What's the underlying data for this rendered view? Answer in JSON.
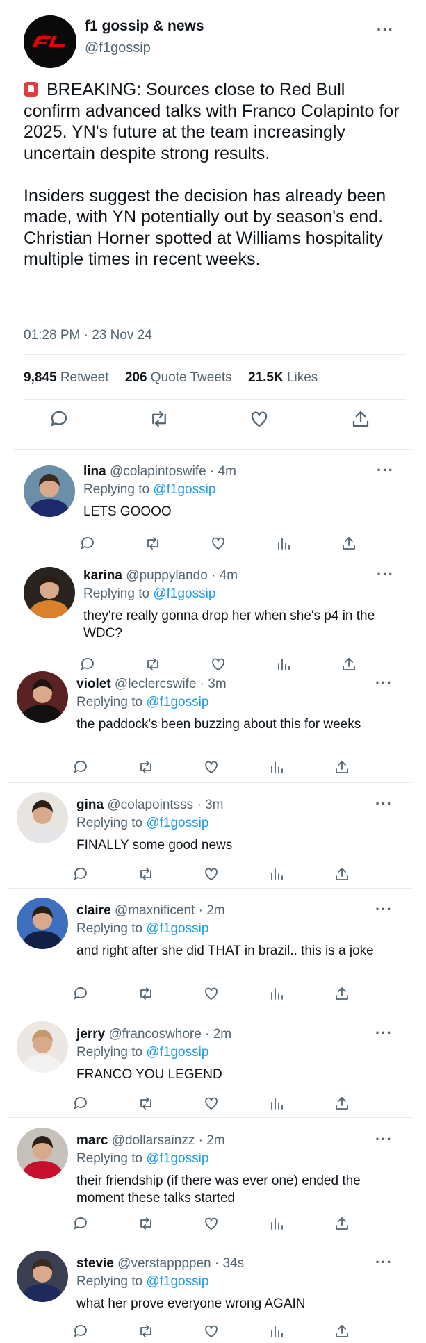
{
  "tweet": {
    "name": "f1 gossip & news",
    "handle": "@f1gossip",
    "logo_text": "F1",
    "paragraph1": "BREAKING: Sources close to Red Bull confirm advanced talks with Franco Colapinto for 2025. YN's future at the team increasingly uncertain despite strong results.",
    "paragraph2": "Insiders suggest the decision has already been made, with YN potentially out by season's end. Christian Horner spotted at Williams hospitality multiple times in recent weeks.",
    "timestamp": "01:28 PM · 23 Nov 24",
    "stats": {
      "retweets_count": "9,845",
      "retweets_label": "Retweet",
      "quotes_count": "206",
      "quotes_label": "Quote Tweets",
      "likes_count": "21.5K",
      "likes_label": "Likes"
    },
    "more_label": "···"
  },
  "icons": [
    "reply-icon",
    "retweet-icon",
    "like-icon",
    "views-icon",
    "share-icon"
  ],
  "colors": {
    "link": "#1d9bf0",
    "secondary": "#536471",
    "text": "#0f1419",
    "alarm": "#e23d3d",
    "logo_red": "#e10600"
  },
  "replies": [
    {
      "name": "lina",
      "handle": "@colapintoswife",
      "time": "· 4m",
      "replying_prefix": "Replying to",
      "replying_to": "@f1gossip",
      "text": "LETS GOOOO",
      "more": "···"
    },
    {
      "name": "karina",
      "handle": "@puppylando",
      "time": "· 4m",
      "replying_prefix": "Replying to",
      "replying_to": "@f1gossip",
      "text": "they're really gonna drop her when she's p4 in the WDC?",
      "more": "···"
    },
    {
      "name": "violet",
      "handle": "@leclercswife",
      "time": "· 3m",
      "replying_prefix": "Replying to",
      "replying_to": "@f1gossip",
      "text": "the paddock's been buzzing about this for weeks",
      "more": "···"
    },
    {
      "name": "gina",
      "handle": "@colapointsss",
      "time": "· 3m",
      "replying_prefix": "Replying to",
      "replying_to": "@f1gossip",
      "text": "FINALLY some good news",
      "more": "···"
    },
    {
      "name": "claire",
      "handle": "@maxnificent",
      "time": "· 2m",
      "replying_prefix": "Replying to",
      "replying_to": "@f1gossip",
      "text": "and right after she did THAT in brazil.. this is a joke",
      "more": "···"
    },
    {
      "name": "jerry",
      "handle": "@francoswhore",
      "time": "· 2m",
      "replying_prefix": "Replying to",
      "replying_to": "@f1gossip",
      "text": "FRANCO YOU LEGEND",
      "more": "···"
    },
    {
      "name": "marc",
      "handle": "@dollarsainzz",
      "time": "· 2m",
      "replying_prefix": "Replying to",
      "replying_to": "@f1gossip",
      "text": "their friendship (if there was ever one) ended the moment these talks started",
      "more": "···"
    },
    {
      "name": "stevie",
      "handle": "@verstappppen",
      "time": "· 34s",
      "replying_prefix": "Replying to",
      "replying_to": "@f1gossip",
      "text": "what her prove everyone wrong AGAIN",
      "more": "···"
    }
  ]
}
